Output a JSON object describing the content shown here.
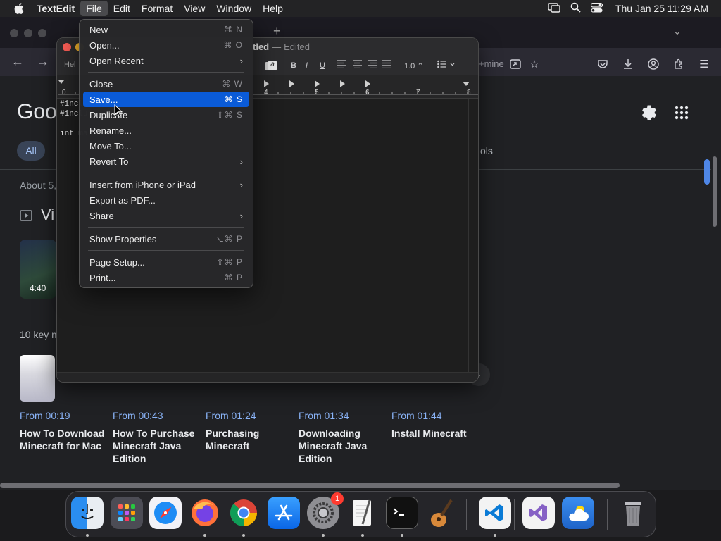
{
  "menubar": {
    "app_name": "TextEdit",
    "menus": [
      "File",
      "Edit",
      "Format",
      "View",
      "Window",
      "Help"
    ],
    "clock": "Thu Jan 25  11:29 AM"
  },
  "browser": {
    "address_fragment": "+mine",
    "logo_text": "Goo",
    "filter_all": "All",
    "tools_fragment": "ols",
    "about_fragment": "About 5,",
    "videos_heading_fragment": "Vi",
    "video_duration": "4:40",
    "key_moments_fragment": "10 key m",
    "moments": [
      {
        "from": "From 00:19",
        "title": "How To Download Minecraft for Mac"
      },
      {
        "from": "From 00:43",
        "title": "How To Purchase Minecraft Java Edition"
      },
      {
        "from": "From 01:24",
        "title": "Purchasing Minecraft"
      },
      {
        "from": "From 01:34",
        "title": "Downloading Minecraft Java Edition"
      },
      {
        "from": "From 01:44",
        "title": "Install Minecraft"
      }
    ]
  },
  "textedit": {
    "title_fragment": "tled",
    "title_sep": "—",
    "title_status": "Edited",
    "font_fragment": "Hel",
    "line_spacing": "1.0",
    "ruler_labels": [
      "0",
      "4",
      "5",
      "6",
      "7",
      "8"
    ],
    "doc_lines": [
      "#inclu",
      "#inclu",
      "int ma"
    ]
  },
  "filemenu": {
    "items": [
      {
        "label": "New",
        "shortcut": "⌘ N"
      },
      {
        "label": "Open...",
        "shortcut": "⌘ O"
      },
      {
        "label": "Open Recent",
        "submenu": "›"
      },
      {
        "label": "Close",
        "shortcut": "⌘ W"
      },
      {
        "label": "Save...",
        "shortcut": "⌘ S"
      },
      {
        "label": "Duplicate",
        "shortcut": "⇧⌘ S"
      },
      {
        "label": "Rename..."
      },
      {
        "label": "Move To..."
      },
      {
        "label": "Revert To",
        "submenu": "›"
      },
      {
        "label": "Insert from iPhone or iPad",
        "submenu": "›"
      },
      {
        "label": "Export as PDF..."
      },
      {
        "label": "Share",
        "submenu": "›"
      },
      {
        "label": "Show Properties",
        "shortcut": "⌥⌘ P"
      },
      {
        "label": "Page Setup...",
        "shortcut": "⇧⌘ P"
      },
      {
        "label": "Print...",
        "shortcut": "⌘ P"
      }
    ]
  },
  "dock": {
    "settings_badge": "1"
  },
  "colors": {
    "menu_highlight": "#0a5bd8",
    "link_blue": "#8ab4f8"
  }
}
